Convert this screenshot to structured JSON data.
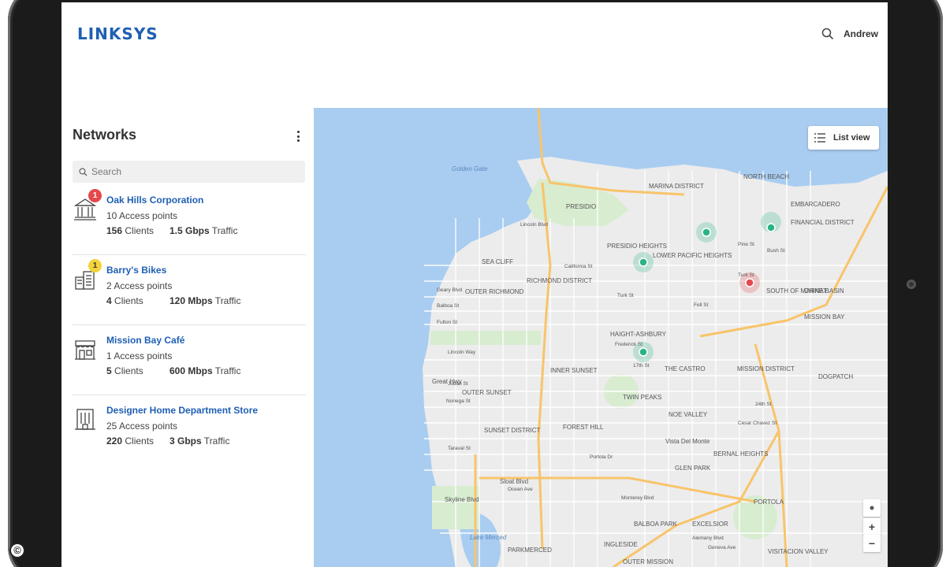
{
  "header": {
    "logo": "LINKSYS",
    "user_name": "Andrew",
    "search_icon": "search-icon"
  },
  "sidebar": {
    "title": "Networks",
    "menu_icon": "more-vertical-icon",
    "search": {
      "placeholder": "Search",
      "icon": "search-icon"
    },
    "networks": [
      {
        "name": "Oak Hills Corporation",
        "icon": "government-building-icon",
        "badge": "1",
        "badge_color": "#e5484d",
        "access_points": "10 Access points",
        "clients_value": "156",
        "clients_label": " Clients",
        "traffic_value": "1.5 Gbps",
        "traffic_label": " Traffic"
      },
      {
        "name": "Barry's Bikes",
        "icon": "office-building-icon",
        "badge": "1",
        "badge_color": "#f3d33a",
        "access_points": "2 Access points",
        "clients_value": "4",
        "clients_label": " Clients",
        "traffic_value": "120 Mbps",
        "traffic_label": " Traffic"
      },
      {
        "name": "Mission Bay Café",
        "icon": "storefront-icon",
        "access_points": "1 Access points",
        "clients_value": "5",
        "clients_label": " Clients",
        "traffic_value": "600 Mbps",
        "traffic_label": " Traffic"
      },
      {
        "name": "Designer Home Department Store",
        "icon": "department-store-icon",
        "access_points": "25 Access points",
        "clients_value": "220",
        "clients_label": " Clients",
        "traffic_value": "3 Gbps",
        "traffic_label": " Traffic"
      }
    ]
  },
  "map": {
    "list_view_label": "List view",
    "list_icon": "list-icon",
    "controls": {
      "locate": "locate-icon",
      "zoom_in": "+",
      "zoom_out": "−"
    },
    "colors": {
      "water": "#a9cdf0",
      "land": "#ececec",
      "park": "#d8ecd0",
      "highway": "#f8c46a",
      "marker_ok": "#2bb384",
      "marker_alert": "#e5484d"
    },
    "labels": [
      "Golden Gate",
      "PRESIDIO",
      "MARINA DISTRICT",
      "NORTH BEACH",
      "EMBARCADERO",
      "FINANCIAL DISTRICT",
      "PRESIDIO HEIGHTS",
      "LOWER PACIFIC HEIGHTS",
      "SEA CLIFF",
      "RICHMOND DISTRICT",
      "OUTER RICHMOND",
      "SOUTH OF MARKET",
      "CHINA BASIN",
      "MISSION BAY",
      "HAIGHT-ASHBURY",
      "INNER SUNSET",
      "THE CASTRO",
      "MISSION DISTRICT",
      "DOGPATCH",
      "OUTER SUNSET",
      "TWIN PEAKS",
      "NOE VALLEY",
      "SUNSET DISTRICT",
      "FOREST HILL",
      "Vista Del Monte",
      "BERNAL HEIGHTS",
      "GLEN PARK",
      "PORTOLA",
      "BALBOA PARK",
      "EXCELSIOR",
      "INGLESIDE",
      "PARKMERCED",
      "VISITACION VALLEY",
      "OUTER MISSION",
      "Lake Merced",
      "Sloat Blvd",
      "Skyline Blvd",
      "Great Hwy",
      "Geary Blvd",
      "Balboa St",
      "Fulton St",
      "Lincoln Way",
      "Judah St",
      "Noriega St",
      "Taraval St",
      "Ocean Ave",
      "Turk St",
      "Fell St",
      "Lincoln Blvd",
      "California St",
      "Portola Dr",
      "Monterey Blvd",
      "Cesar Chavez St",
      "24th St",
      "17th St",
      "Frederick St",
      "Bush St",
      "Pine St",
      "Turk St",
      "Geneva Ave",
      "Alemany Blvd"
    ]
  }
}
